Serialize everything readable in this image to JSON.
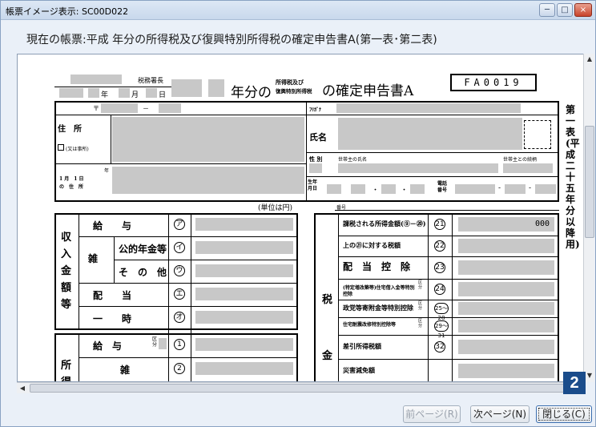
{
  "window": {
    "title": "帳票イメージ表示: SC00D022",
    "min": "─",
    "max": "□",
    "close": "×"
  },
  "caption": "現在の帳票:平成 年分の所得税及び復興特別所得税の確定申告書A(第一表･第二表)",
  "form": {
    "office_suffix": "税務署長",
    "date_year": "年",
    "date_month": "月",
    "date_day": "日",
    "heading_prefix": "年分の",
    "heading_small_top": "所得税及び",
    "heading_small_bottom": "復興特別所得税",
    "heading_suffix": "の確定申告書A",
    "form_number": "FA0019",
    "postal_mark": "〒",
    "postal_dash": "－",
    "address_label": "住　所",
    "office_label": "(又は事所)",
    "date_label_line1": "1 月　1 日",
    "date_label_line2": "の　住　所",
    "date_label_year": "年",
    "furigana_label": "ﾌﾘｶﾞﾅ",
    "name_label": "氏名",
    "sex_label": "性 別",
    "head_of_household_label": "世帯主の氏名",
    "relation_label": "世帯主との続柄",
    "birth_label": "生年月日",
    "birth_dot1": "・",
    "birth_dot2": "・",
    "phone_label": "電話番号",
    "phone_dash1": "-",
    "phone_dash2": "-",
    "unit_label": "(単位は円)",
    "number_label": "番号",
    "side_label": "第一表(平成二十五年分以降用)",
    "income_group_label": "収入金額等",
    "income_rows": [
      {
        "label": "給　　与",
        "circle": "ア"
      },
      {
        "label": "公的年金等",
        "circle": "イ"
      },
      {
        "label": "そ　の　他",
        "circle": "ウ"
      },
      {
        "label": "配　　当",
        "circle": "エ"
      },
      {
        "label": "一　　時",
        "circle": "オ"
      }
    ],
    "misc_label": "雑",
    "shotoku_group_label": "所得",
    "shotoku_rows": [
      {
        "label": "給　与",
        "circle": "1"
      },
      {
        "label": "雑",
        "circle": "2"
      }
    ],
    "kubun_label": "区分",
    "tax_group_label": "税金",
    "tax_rows": [
      {
        "label": "課税される所得金額(⑨－⑳)",
        "circle": "21",
        "value": "000"
      },
      {
        "label": "上の㉑に対する税額",
        "circle": "22",
        "value": ""
      },
      {
        "label": "配　当　控　除",
        "circle": "23",
        "value": ""
      },
      {
        "label": "(特定増改築等)住宅借入金等特別控除",
        "circle": "24",
        "value": ""
      },
      {
        "label": "政党等寄附金等特別控除",
        "circle": "25～28",
        "value": ""
      },
      {
        "label": "住宅耐震改修特別控除等",
        "circle": "29～31",
        "value": ""
      },
      {
        "label": "差引所得税額",
        "circle": "32",
        "value": ""
      },
      {
        "label": "災害減免額",
        "circle": "",
        "value": ""
      }
    ]
  },
  "scroll": {
    "up": "▲",
    "down": "▼",
    "left": "◀",
    "right": "▶"
  },
  "badge": "2",
  "buttons": {
    "prev": "前ページ(R)",
    "next": "次ページ(N)",
    "close": "閉じる(C)"
  }
}
